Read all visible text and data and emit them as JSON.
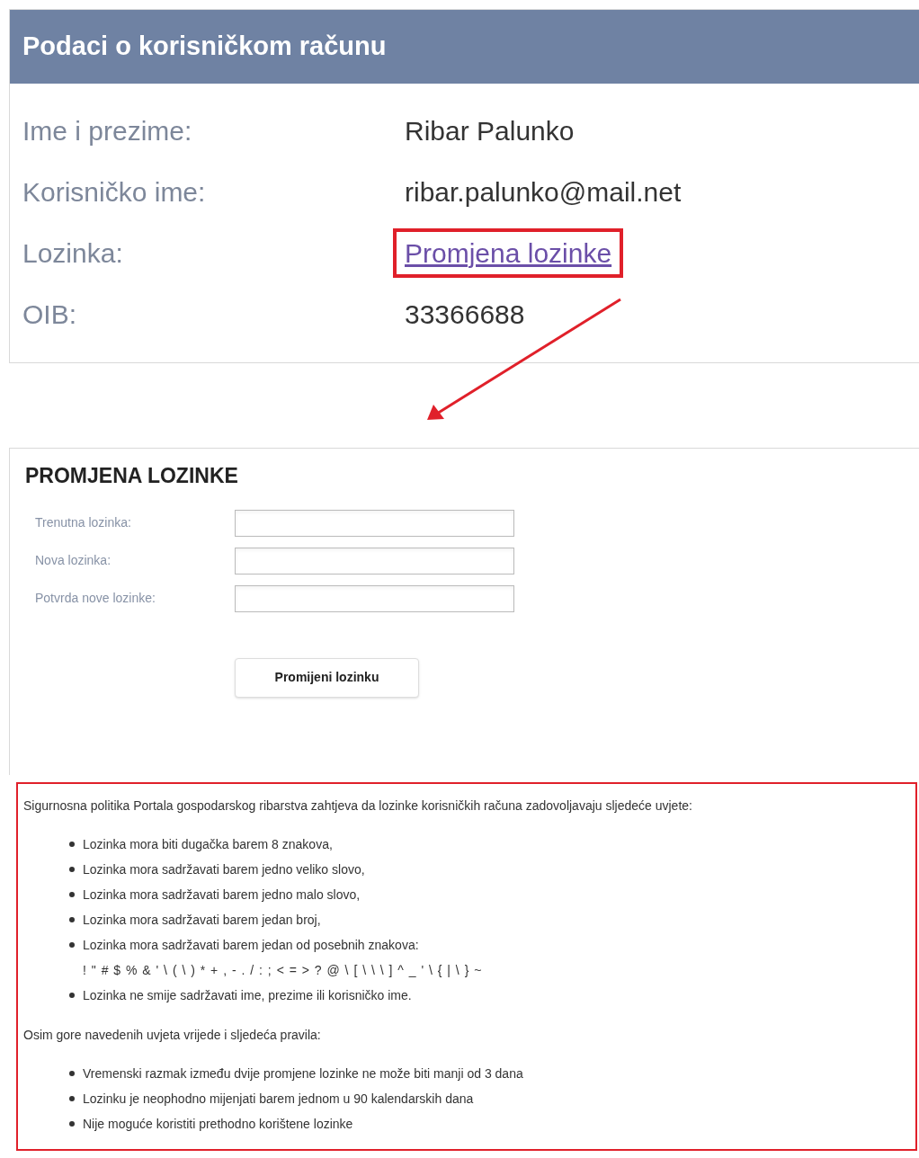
{
  "account": {
    "title": "Podaci o korisničkom računu",
    "rows": [
      {
        "label": "Ime i prezime:",
        "value": "Ribar Palunko",
        "kind": "text",
        "highlighted": false
      },
      {
        "label": "Korisničko ime:",
        "value": "ribar.palunko@mail.net",
        "kind": "text",
        "highlighted": false
      },
      {
        "label": "Lozinka:",
        "value": "Promjena lozinke",
        "kind": "link",
        "highlighted": true
      },
      {
        "label": "OIB:",
        "value": "33366688",
        "kind": "text",
        "highlighted": false
      }
    ]
  },
  "password_change": {
    "title": "PROMJENA LOZINKE",
    "fields": [
      {
        "label": "Trenutna lozinka:"
      },
      {
        "label": "Nova lozinka:"
      },
      {
        "label": "Potvrda nove lozinke:"
      }
    ],
    "submit": "Promijeni lozinku"
  },
  "policy": {
    "intro": "Sigurnosna politika Portala gospodarskog ribarstva zahtjeva da lozinke korisničkih računa zadovoljavaju sljedeće uvjete:",
    "requirements": [
      {
        "text": "Lozinka mora biti dugačka barem 8 znakova,"
      },
      {
        "text": "Lozinka mora sadržavati barem jedno veliko slovo,"
      },
      {
        "text": "Lozinka mora sadržavati barem jedno malo slovo,"
      },
      {
        "text": "Lozinka mora sadržavati barem jedan broj,"
      },
      {
        "text": "Lozinka mora sadržavati barem jedan od posebnih znakova:",
        "detail": "! \" # $ % & ' \\ ( \\ ) * + , - . / : ; < = > ? @ \\ [ \\ \\ \\ ] ^ _ ' \\ { | \\ } ~"
      },
      {
        "text": "Lozinka ne smije sadržavati ime, prezime ili korisničko ime."
      }
    ],
    "rules_intro": "Osim gore navedenih uvjeta vrijede i sljedeća pravila:",
    "rules": [
      "Vremenski razmak između dvije promjene lozinke ne može biti manji od 3 dana",
      "Lozinku je neophodno mijenjati barem jednom u 90 kalendarskih dana",
      "Nije moguće koristiti prethodno korištene lozinke"
    ]
  }
}
